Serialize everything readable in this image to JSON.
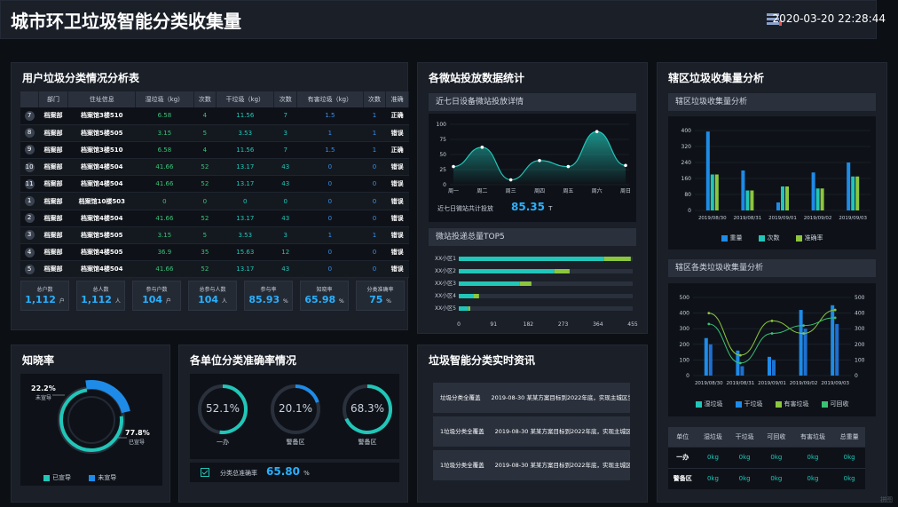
{
  "header": {
    "title": "城市环卫垃圾智能分类收集量",
    "datetime": "2020-03-20 22:28:44",
    "watermark": "拼图"
  },
  "user_table": {
    "title": "用户垃圾分类情况分析表",
    "columns": [
      "",
      "部门",
      "住址信息",
      "湿垃圾（kg）",
      "次数",
      "干垃圾（kg）",
      "次数",
      "有害垃圾（kg）",
      "次数",
      "准确"
    ],
    "rows": [
      [
        "7",
        "档案部",
        "档案馆3楼510",
        "6.58",
        "4",
        "11.56",
        "7",
        "1.5",
        "1",
        "正确"
      ],
      [
        "8",
        "档案部",
        "档案馆5楼505",
        "3.15",
        "5",
        "3.53",
        "3",
        "1",
        "1",
        "错误"
      ],
      [
        "9",
        "档案部",
        "档案馆3楼510",
        "6.58",
        "4",
        "11.56",
        "7",
        "1.5",
        "1",
        "正确"
      ],
      [
        "10",
        "档案部",
        "档案馆4楼504",
        "41.66",
        "52",
        "13.17",
        "43",
        "0",
        "0",
        "错误"
      ],
      [
        "11",
        "档案部",
        "档案馆4楼504",
        "41.66",
        "52",
        "13.17",
        "43",
        "0",
        "0",
        "错误"
      ],
      [
        "1",
        "档案部",
        "档案馆10楼503",
        "0",
        "0",
        "0",
        "0",
        "0",
        "0",
        "错误"
      ],
      [
        "2",
        "档案部",
        "档案馆4楼504",
        "41.66",
        "52",
        "13.17",
        "43",
        "0",
        "0",
        "错误"
      ],
      [
        "3",
        "档案部",
        "档案馆5楼505",
        "3.15",
        "5",
        "3.53",
        "3",
        "1",
        "1",
        "错误"
      ],
      [
        "4",
        "档案部",
        "档案馆4楼505",
        "36.9",
        "35",
        "15.63",
        "12",
        "0",
        "0",
        "错误"
      ],
      [
        "5",
        "档案部",
        "档案馆4楼504",
        "41.66",
        "52",
        "13.17",
        "43",
        "0",
        "0",
        "错误"
      ]
    ]
  },
  "stats": [
    {
      "label": "总户数",
      "value": "1,112",
      "unit": "户"
    },
    {
      "label": "总人数",
      "value": "1,112",
      "unit": "人"
    },
    {
      "label": "参与户数",
      "value": "104",
      "unit": "户"
    },
    {
      "label": "总参与人数",
      "value": "104",
      "unit": "人"
    },
    {
      "label": "参与率",
      "value": "85.93",
      "unit": "%"
    },
    {
      "label": "知晓率",
      "value": "65.98",
      "unit": "%"
    },
    {
      "label": "分类准确率",
      "value": "75",
      "unit": "%"
    }
  ],
  "micro_stations": {
    "title": "各微站投放数据统计",
    "week_subtitle": "近七日设备微站投放详情",
    "week_total_label": "近七日微站共计投放",
    "week_total_value": "85.35",
    "week_total_unit": "T",
    "top5_subtitle": "微站投递总量TOP5"
  },
  "district": {
    "title": "辖区垃圾收集量分析",
    "sub1": "辖区垃圾收集量分析",
    "sub2": "辖区各类垃圾收集量分析"
  },
  "awareness": {
    "title": "知晓率",
    "unaware_pct": "22.2%",
    "unaware_label": "未宣导",
    "aware_pct": "77.8%",
    "aware_label": "已宣导",
    "legend_aware": "已宣导",
    "legend_unaware": "未宣导",
    "aware_value": 77.8
  },
  "accuracy": {
    "title": "各单位分类准确率情况",
    "rings": [
      {
        "pct": "52.1%",
        "name": "一办",
        "value": 52.1
      },
      {
        "pct": "20.1%",
        "name": "警备区",
        "value": 20.1
      },
      {
        "pct": "68.3%",
        "name": "警备区",
        "value": 68.3
      }
    ],
    "total_label": "分类总准确率",
    "total_value": "65.80",
    "total_unit": "%"
  },
  "news": {
    "title": "垃圾智能分类实时资讯",
    "items": [
      {
        "tag": "垃圾分类全覆盖",
        "text": "2019-08-30 某某方案目标到2022年底，实现主城区生"
      },
      {
        "tag": "1垃圾分类全覆盖",
        "text": "2019-08-30 某某方案目标到2022年底，实现主城区"
      },
      {
        "tag": "1垃圾分类全覆盖",
        "text": "2019-08-30 某某方案目标到2022年底，实现主城区"
      }
    ]
  },
  "unit_table": {
    "columns": [
      "单位",
      "湿垃圾",
      "干垃圾",
      "可回收",
      "有害垃圾",
      "总重量"
    ],
    "rows": [
      [
        "一办",
        "0kg",
        "0kg",
        "0kg",
        "0kg",
        "0kg"
      ],
      [
        "警备区",
        "0kg",
        "0kg",
        "0kg",
        "0kg",
        "0kg"
      ]
    ]
  },
  "colors": {
    "teal": "#21c6b8",
    "blue": "#1e8be8",
    "green": "#8cc63f",
    "panel": "#1a1f28"
  },
  "chart_data": [
    {
      "type": "area",
      "title": "近七日设备微站投放详情",
      "categories": [
        "周一",
        "周二",
        "周三",
        "周四",
        "周五",
        "周六",
        "周日"
      ],
      "values": [
        30,
        62,
        8,
        40,
        30,
        88,
        32
      ],
      "ylim": [
        0,
        100
      ],
      "yticks": [
        0,
        25,
        50,
        75,
        100
      ]
    },
    {
      "type": "bar",
      "title": "微站投递总量TOP5",
      "orientation": "horizontal",
      "categories": [
        "XX小区1",
        "XX小区2",
        "XX小区3",
        "XX小区4",
        "XX小区5"
      ],
      "series": [
        {
          "values": [
            380,
            250,
            160,
            38,
            25
          ]
        },
        {
          "values": [
            70,
            40,
            30,
            15,
            5
          ]
        }
      ],
      "xlim": [
        0,
        455
      ],
      "xticks": [
        0,
        91,
        182,
        273,
        364,
        455
      ]
    },
    {
      "type": "bar",
      "title": "辖区垃圾收集量分析",
      "categories": [
        "2019/08/30",
        "2019/08/31",
        "2019/09/01",
        "2019/09/02",
        "2019/09/03"
      ],
      "series": [
        {
          "name": "重量",
          "values": [
            395,
            200,
            40,
            190,
            240
          ]
        },
        {
          "name": "次数",
          "values": [
            180,
            100,
            120,
            110,
            170
          ]
        },
        {
          "name": "准确率",
          "values": [
            180,
            100,
            120,
            110,
            170
          ]
        }
      ],
      "ylim": [
        0,
        400
      ],
      "yticks": [
        0,
        80,
        160,
        240,
        320,
        400
      ],
      "legend": "bottom"
    },
    {
      "type": "bar",
      "title": "辖区各类垃圾收集量分析",
      "categories": [
        "2019/08/30",
        "2019/08/31",
        "2019/09/01",
        "2019/09/02",
        "2019/09/03"
      ],
      "series": [
        {
          "name": "湿垃圾",
          "values": [
            240,
            160,
            120,
            420,
            450
          ]
        },
        {
          "name": "干垃圾",
          "values": [
            200,
            60,
            100,
            300,
            330
          ]
        },
        {
          "name": "有害垃圾",
          "values": [
            400,
            130,
            350,
            270,
            420
          ]
        },
        {
          "name": "可回收",
          "values": [
            330,
            80,
            270,
            320,
            370
          ]
        }
      ],
      "ylim": [
        0,
        500
      ],
      "yticks": [
        0,
        100,
        200,
        300,
        400,
        500
      ],
      "line_series": [
        "有害垃圾",
        "可回收"
      ],
      "legend": "bottom"
    },
    {
      "type": "pie",
      "title": "知晓率",
      "categories": [
        "已宣导",
        "未宣导"
      ],
      "values": [
        77.8,
        22.2
      ]
    }
  ]
}
